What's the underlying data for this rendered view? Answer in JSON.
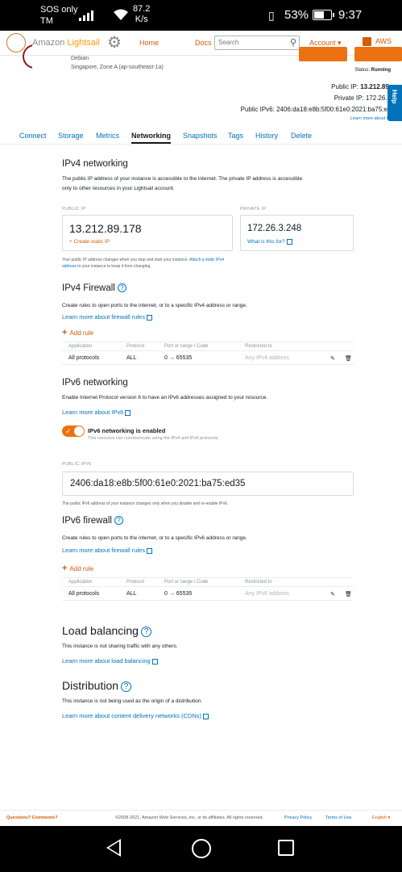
{
  "status_bar": {
    "carrier": "SOS only TM",
    "speed_value": "87.2",
    "speed_unit": "K/s",
    "battery": "53%",
    "time": "9:37"
  },
  "header": {
    "brand_amazon": "Amazon",
    "brand_product": "Lightsail",
    "home": "Home",
    "docs": "Docs",
    "search_placeholder": "Search",
    "account": "Account ▾",
    "aws": "AWS"
  },
  "instance": {
    "os": "Debian",
    "zone": "Singapore, Zone A (ap-southeast-1a)",
    "public_ip_label": "Public IP:",
    "public_ip": "13.212.89.",
    "private_ip_label": "Private IP:",
    "private_ip": "172.26.3",
    "ipv6_label": "Public IPv6:",
    "ipv6": "2406:da18:e8b:5f00:61e0:2021:ba75:e",
    "learn_more": "Learn more about IP",
    "status_label": "Status:",
    "status": "Running"
  },
  "help_tab": "Help",
  "tabs": [
    "Connect",
    "Storage",
    "Metrics",
    "Networking",
    "Snapshots",
    "Tags",
    "History",
    "Delete"
  ],
  "ipv4": {
    "title": "IPv4 networking",
    "desc": "The public IP address of your instance is accessible to the internet. The private IP address is accessible only to other resources in your Lightsail account.",
    "public_label": "PUBLIC IP",
    "public_ip": "13.212.89.178",
    "create_static": "+ Create static IP",
    "private_label": "PRIVATE IP",
    "private_ip": "172.26.3.248",
    "what_is": "What is this for?",
    "note_a": "Your public IP address changes when you stop and start your instance. ",
    "note_link": "Attach a static IPv4 address",
    "note_b": " to your instance to keep it from changing."
  },
  "ipv4_firewall": {
    "title": "IPv4 Firewall",
    "desc": "Create rules to open ports to the internet, or to a specific IPv4 address or range.",
    "learn": "Learn more about firewall rules",
    "add_rule": "Add rule",
    "headers": [
      "Application",
      "Protocol",
      "Port or range / Code",
      "Restricted to"
    ],
    "row": {
      "application": "All protocols",
      "protocol": "ALL",
      "port": "0 → 65535",
      "restricted": "Any IPv4 address"
    }
  },
  "ipv6": {
    "title": "IPv6 networking",
    "desc": "Enable Internet Protocol version 6 to have an IPv6 addresses assigned to your resource.",
    "learn": "Learn more about IPv6",
    "toggle_label": "IPv6 networking is enabled",
    "toggle_sub": "This resource can communicate using the IPv4 and IPv6 protocols.",
    "public_label": "PUBLIC IPV6",
    "address": "2406:da18:e8b:5f00:61e0:2021:ba75:ed35",
    "note": "The public IPv6 address of your instance changes only when you disable and re-enable IPv6."
  },
  "ipv6_firewall": {
    "title": "IPv6 firewall",
    "desc": "Create rules to open ports to the internet, or to a specific IPv6 address or range.",
    "learn": "Learn more about firewall rules",
    "add_rule": "Add rule",
    "headers": [
      "Application",
      "Protocol",
      "Port or range / Code",
      "Restricted to"
    ],
    "row": {
      "application": "All protocols",
      "protocol": "ALL",
      "port": "0 → 65535",
      "restricted": "Any IPv6 address"
    }
  },
  "load_balancing": {
    "title": "Load balancing",
    "desc": "This instance is not sharing traffic with any others.",
    "learn": "Learn more about load balancing"
  },
  "distribution": {
    "title": "Distribution",
    "desc": "This instance is not being used as the origin of a distribution.",
    "learn": "Learn more about content delivery networks (CDNs)"
  },
  "footer": {
    "questions": "Questions? Comments?",
    "copyright": "©2008-2021, Amazon Web Services, Inc. or its affiliates. All rights reserved.",
    "privacy": "Privacy Policy",
    "terms": "Terms of Use",
    "language": "English ▾"
  }
}
